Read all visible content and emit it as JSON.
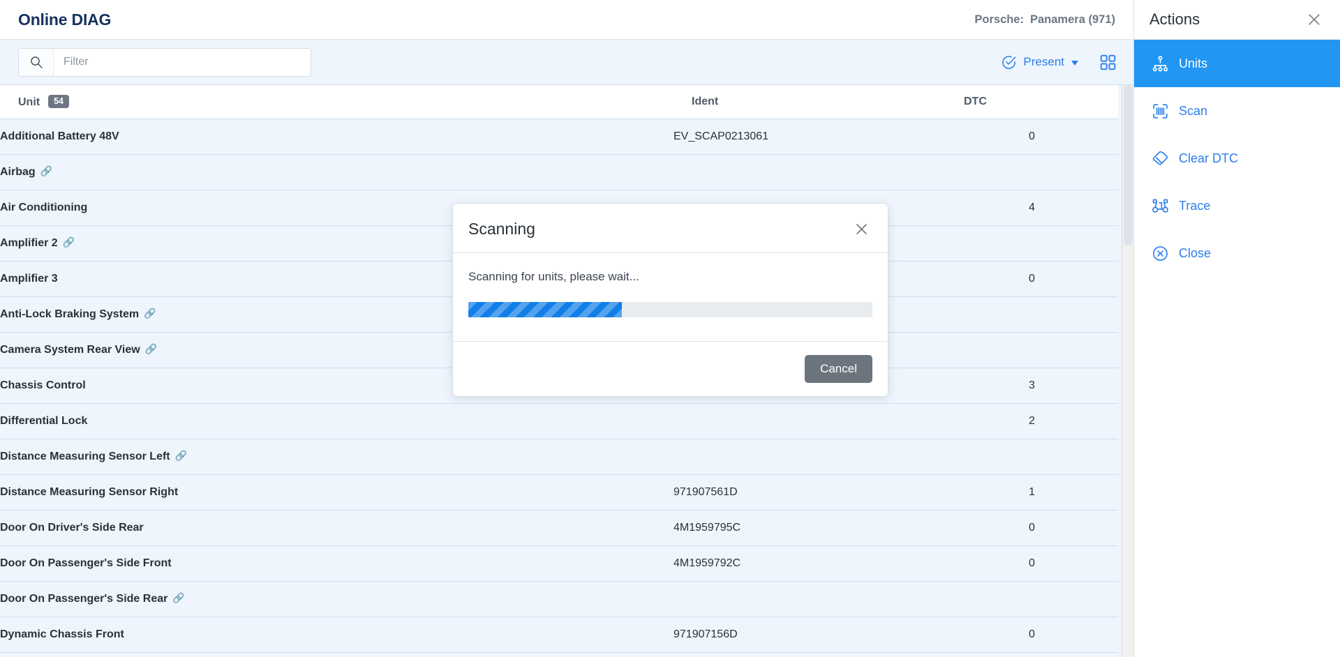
{
  "app": {
    "title": "Online DIAG",
    "vehicle": {
      "make_label": "Porsche:",
      "model_label": "Panamera (971)"
    }
  },
  "toolbar": {
    "filter_placeholder": "Filter",
    "filter_value": "",
    "search_icon": "search-icon",
    "present_label": "Present",
    "present_icon": "check-circle-icon",
    "grid_icon": "grid-view-icon"
  },
  "table": {
    "columns": [
      "Unit",
      "Ident",
      "DTC"
    ],
    "unit_count_badge": "54",
    "link_icon": "link-icon",
    "rows": [
      {
        "unit": "Additional Battery 48V",
        "link": false,
        "ident": "EV_SCAP0213061",
        "dtc": "0"
      },
      {
        "unit": "Airbag",
        "link": true,
        "ident": "",
        "dtc": ""
      },
      {
        "unit": "Air Conditioning",
        "link": false,
        "ident": "",
        "dtc": "4"
      },
      {
        "unit": "Amplifier 2",
        "link": true,
        "ident": "",
        "dtc": ""
      },
      {
        "unit": "Amplifier 3",
        "link": false,
        "ident": "",
        "dtc": "0"
      },
      {
        "unit": "Anti-Lock Braking System",
        "link": true,
        "ident": "",
        "dtc": ""
      },
      {
        "unit": "Camera System Rear View",
        "link": true,
        "ident": "",
        "dtc": ""
      },
      {
        "unit": "Chassis Control",
        "link": false,
        "ident": "",
        "dtc": "3"
      },
      {
        "unit": "Differential Lock",
        "link": false,
        "ident": "",
        "dtc": "2"
      },
      {
        "unit": "Distance Measuring Sensor Left",
        "link": true,
        "ident": "",
        "dtc": ""
      },
      {
        "unit": "Distance Measuring Sensor Right",
        "link": false,
        "ident": "971907561D",
        "dtc": "1"
      },
      {
        "unit": "Door On Driver's Side Rear",
        "link": false,
        "ident": "4M1959795C",
        "dtc": "0"
      },
      {
        "unit": "Door On Passenger's Side Front",
        "link": false,
        "ident": "4M1959792C",
        "dtc": "0"
      },
      {
        "unit": "Door On Passenger's Side Rear",
        "link": true,
        "ident": "",
        "dtc": ""
      },
      {
        "unit": "Dynamic Chassis Front",
        "link": false,
        "ident": "971907156D",
        "dtc": "0"
      }
    ]
  },
  "actions": {
    "title": "Actions",
    "close_icon": "close-icon",
    "items": [
      {
        "label": "Units",
        "icon": "units-hierarchy-icon",
        "active": true
      },
      {
        "label": "Scan",
        "icon": "barcode-scan-icon",
        "active": false
      },
      {
        "label": "Clear DTC",
        "icon": "eraser-icon",
        "active": false
      },
      {
        "label": "Trace",
        "icon": "binoculars-icon",
        "active": false
      },
      {
        "label": "Close",
        "icon": "close-circle-icon",
        "active": false
      }
    ]
  },
  "modal": {
    "title": "Scanning",
    "message": "Scanning for units, please wait...",
    "progress_percent": 38,
    "cancel_label": "Cancel",
    "close_icon": "close-icon"
  },
  "colors": {
    "accent": "#2196f3",
    "link": "#1a73e8",
    "row_bg": "#eef5fd",
    "badge_bg": "#6e7683",
    "cancel_bg": "#6c757d"
  }
}
